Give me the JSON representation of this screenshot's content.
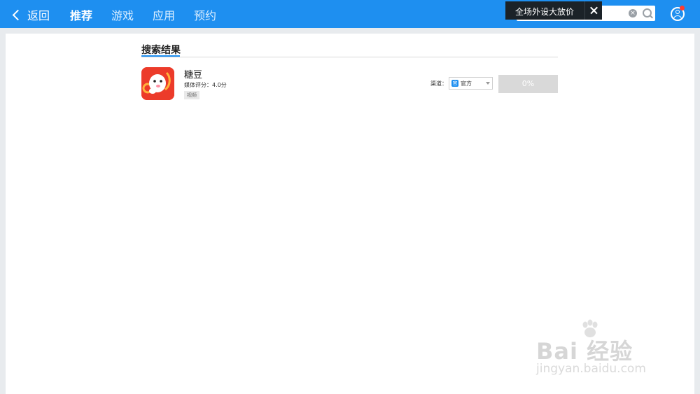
{
  "header": {
    "back_label": "返回",
    "tabs": [
      {
        "label": "推荐",
        "active": true
      },
      {
        "label": "游戏",
        "active": false
      },
      {
        "label": "应用",
        "active": false
      },
      {
        "label": "预约",
        "active": false
      }
    ],
    "promo_text": "全场外设大放价",
    "search": {
      "value": "",
      "placeholder": ""
    },
    "colors": {
      "bar": "#1e8ff0",
      "badge": "#ff3b30"
    }
  },
  "main": {
    "section_title": "搜索结果",
    "results": [
      {
        "name": "糖豆",
        "rating": "媒体评分：4.0分",
        "tag": "视频",
        "channel_label": "渠道：",
        "channel_value": "官方",
        "progress_label": "0%",
        "progress": 0
      }
    ]
  },
  "watermark": {
    "brand": "Bai 经验",
    "url": "jingyan.baidu.com"
  }
}
